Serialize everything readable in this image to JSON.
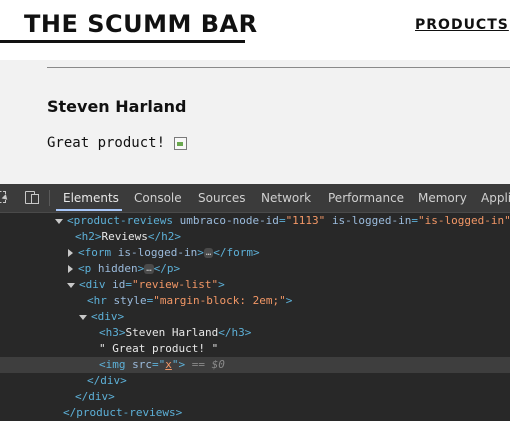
{
  "header": {
    "logo": "THE SCUMM BAR",
    "nav_products": "PRODUCTS"
  },
  "review": {
    "author": "Steven Harland",
    "text": "Great product!"
  },
  "devtools": {
    "tabs": [
      "Elements",
      "Console",
      "Sources",
      "Network",
      "Performance",
      "Memory",
      "Appli"
    ],
    "active_tab": "Elements",
    "colors": {
      "tag": "#5db0d7",
      "attr_name": "#9bbbdc",
      "attr_value": "#f29766",
      "text": "#e8e8e8",
      "panel_bg": "#282828",
      "selected_bg": "#3e3e3e"
    },
    "dom": {
      "l1_tag": "<product-reviews",
      "l1_attr1": "umbraco-node-id",
      "l1_val1": "\"1113\"",
      "l1_attr2": "is-logged-in",
      "l1_val2": "\"is-logged-in\"",
      "l1_end": ">",
      "l2_open": "<h2>",
      "l2_text": "Reviews",
      "l2_close": "</h2>",
      "l3_open": "<form",
      "l3_attr": "is-logged-in",
      "l3_gt": ">",
      "l3_ellipsis": "…",
      "l3_close": "</form>",
      "l4_open": "<p",
      "l4_attr": "hidden",
      "l4_gt": ">",
      "l4_ellipsis": "…",
      "l4_close": "</p>",
      "l5_open": "<div",
      "l5_attr": "id",
      "l5_val": "\"review-list\"",
      "l5_gt": ">",
      "l6_open": "<hr",
      "l6_attr": "style",
      "l6_val": "\"margin-block: 2em;\"",
      "l6_gt": ">",
      "l7_open": "<div>",
      "l8_open": "<h3>",
      "l8_text": "Steven Harland",
      "l8_close": "</h3>",
      "l9_text": "\" Great product! \"",
      "l10_open": "<img",
      "l10_attr": "src",
      "l10_eq": "=\"",
      "l10_val": "x",
      "l10_q": "\"",
      "l10_gt": ">",
      "l10_marker": "== $0",
      "l11_close": "</div>",
      "l12_close": "</div>",
      "l13_close": "</product-reviews>"
    }
  }
}
